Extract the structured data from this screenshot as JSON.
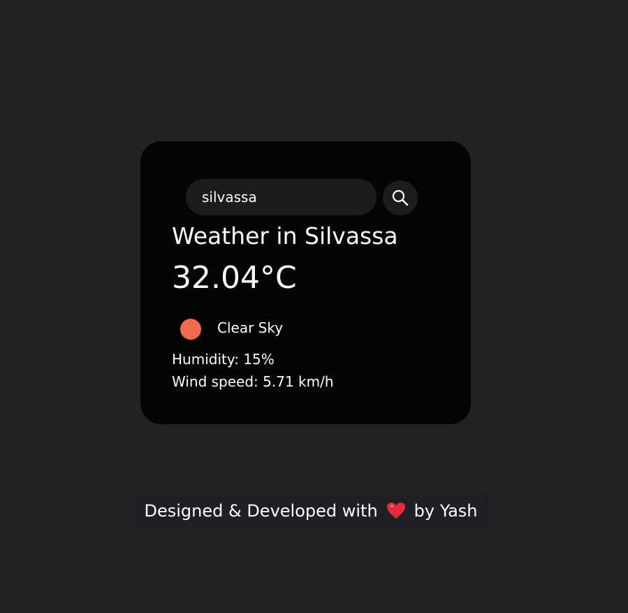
{
  "search": {
    "value": "silvassa",
    "placeholder": ""
  },
  "weather": {
    "city_title": "Weather in Silvassa",
    "temperature": "32.04°C",
    "condition": "Clear Sky",
    "condition_icon": "sun-icon",
    "condition_icon_color": "#ef6c4d",
    "humidity": "Humidity: 15%",
    "wind": "Wind speed: 5.71 km/h"
  },
  "footer": {
    "prefix": "Designed & Developed with",
    "heart_icon": "heart-icon",
    "suffix": "by Yash"
  },
  "colors": {
    "background": "#222222",
    "card": "#050505",
    "input": "#1c1c1c",
    "footer": "#1f2025",
    "heart": "#e8293b"
  }
}
